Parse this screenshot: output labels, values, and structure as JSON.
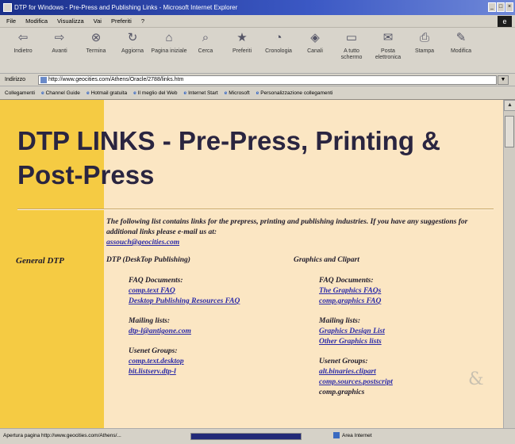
{
  "window": {
    "title": "DTP for Windows - Pre-Press and Publishing Links - Microsoft Internet Explorer",
    "buttons": [
      "_",
      "□",
      "×"
    ]
  },
  "menubar": [
    "File",
    "Modifica",
    "Visualizza",
    "Vai",
    "Preferiti",
    "?"
  ],
  "toolbar": [
    {
      "icon": "back-arrow-icon",
      "label": "Indietro"
    },
    {
      "icon": "forward-arrow-icon",
      "label": "Avanti"
    },
    {
      "icon": "stop-icon",
      "label": "Termina"
    },
    {
      "icon": "refresh-icon",
      "label": "Aggiorna"
    },
    {
      "icon": "home-icon",
      "label": "Pagina iniziale"
    },
    {
      "icon": "search-icon",
      "label": "Cerca"
    },
    {
      "icon": "favorites-icon",
      "label": "Preferiti"
    },
    {
      "icon": "history-icon",
      "label": "Cronologia"
    },
    {
      "icon": "channels-icon",
      "label": "Canali"
    },
    {
      "icon": "fullscreen-icon",
      "label": "A tutto schermo"
    },
    {
      "icon": "mail-icon",
      "label": "Posta elettronica"
    },
    {
      "icon": "print-icon",
      "label": "Stampa"
    },
    {
      "icon": "edit-icon",
      "label": "Modifica"
    }
  ],
  "address": {
    "label": "Indirizzo",
    "url": "http://www.geocities.com/Athens/Oracle/2788/links.htm"
  },
  "links_bar": {
    "label": "Collegamenti",
    "items": [
      "Channel Guide",
      "Hotmail gratuita",
      "Il meglio del Web",
      "Internet Start",
      "Microsoft",
      "Personalizzazione collegamenti"
    ]
  },
  "page": {
    "title": "DTP LINKS - Pre-Press, Printing & Post-Press",
    "intro": "The following list contains links for the prepress, printing and publishing industries. If you have any suggestions for additional links please e-mail us at:",
    "email": "assouch@geocities.com",
    "section_label": "General DTP",
    "columns": [
      {
        "heading": "DTP (DeskTop Publishing)",
        "groups": [
          {
            "title": "FAQ Documents:",
            "items": [
              {
                "text": "comp.text FAQ",
                "link": true
              },
              {
                "text": "Desktop Publishing Resources FAQ",
                "link": true
              }
            ]
          },
          {
            "title": "Mailing lists:",
            "items": [
              {
                "text": "dtp-l@antigone.com",
                "link": true
              }
            ]
          },
          {
            "title": "Usenet Groups:",
            "items": [
              {
                "text": "comp.text.desktop",
                "link": true
              },
              {
                "text": "bit.listserv.dtp-l",
                "link": true
              }
            ]
          }
        ]
      },
      {
        "heading": "Graphics and Clipart",
        "groups": [
          {
            "title": "FAQ Documents:",
            "items": [
              {
                "text": "The Graphics FAQs",
                "link": true
              },
              {
                "text": "comp.graphics FAQ",
                "link": true
              }
            ]
          },
          {
            "title": "Mailing lists:",
            "items": [
              {
                "text": "Graphics Design List",
                "link": true
              },
              {
                "text": "Other Graphics lists",
                "link": true
              }
            ]
          },
          {
            "title": "Usenet Groups:",
            "items": [
              {
                "text": "alt.binaries.clipart",
                "link": true
              },
              {
                "text": "comp.sources.postscript",
                "link": true
              },
              {
                "text": "comp.graphics",
                "link": false
              }
            ]
          }
        ]
      }
    ]
  },
  "statusbar": {
    "text": "Apertura pagina http://www.geocities.com/Athens/...",
    "zone": "Area Internet"
  },
  "colors": {
    "page_background": "#fbe6c3",
    "left_column": "#f5cb43",
    "link": "#2a2aa8",
    "title_text": "#2a2540"
  }
}
